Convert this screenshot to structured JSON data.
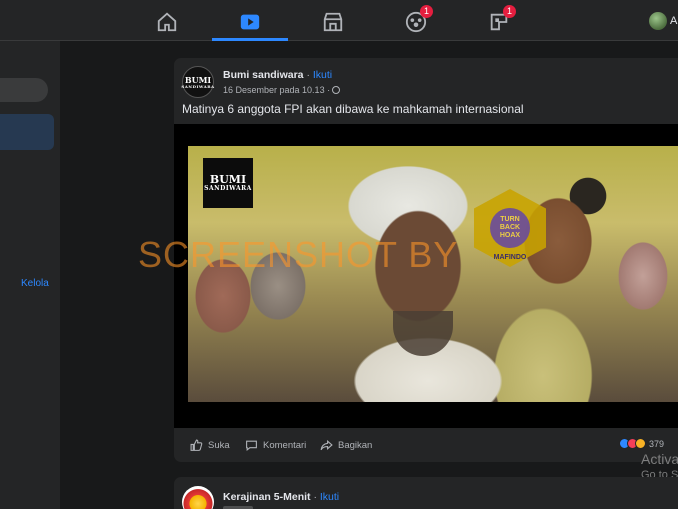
{
  "nav": {
    "items": [
      {
        "name": "home",
        "icon": "home-icon",
        "badge": ""
      },
      {
        "name": "watch",
        "icon": "video-icon",
        "badge": ""
      },
      {
        "name": "marketplace",
        "icon": "store-icon",
        "badge": ""
      },
      {
        "name": "groups",
        "icon": "groups-icon",
        "badge": "1"
      },
      {
        "name": "gaming",
        "icon": "gaming-icon",
        "badge": "1"
      }
    ],
    "profile_initial": "A",
    "accent": "#2d88ff"
  },
  "sidebar": {
    "manage_link": "Kelola"
  },
  "post": {
    "author": "Bumi sandiwara",
    "separator": " · ",
    "follow": "Ikuti",
    "date": "16 Desember pada 10.13 ·",
    "text": "Matinya 6 anggota FPI akan dibawa ke mahkamah internasional",
    "avatar_text": "BUMI",
    "avatar_sub": "SANDIWARA",
    "video": {
      "logo_line1": "BUMI",
      "logo_line2": "SANDIWARA",
      "badge_line1": "TURN",
      "badge_line2": "BACK",
      "badge_line3": "HOAX",
      "badge_org": "MAFINDO"
    },
    "actions": {
      "like": "Suka",
      "comment": "Komentari",
      "share": "Bagikan"
    },
    "reaction_count": "379"
  },
  "watermark": "SCREENSHOT BY",
  "os_overlay": {
    "line1": "Activa",
    "line2": "Go to S"
  },
  "post2": {
    "author": "Kerajinan 5-Menit",
    "separator": " · ",
    "follow": "Ikuti"
  }
}
